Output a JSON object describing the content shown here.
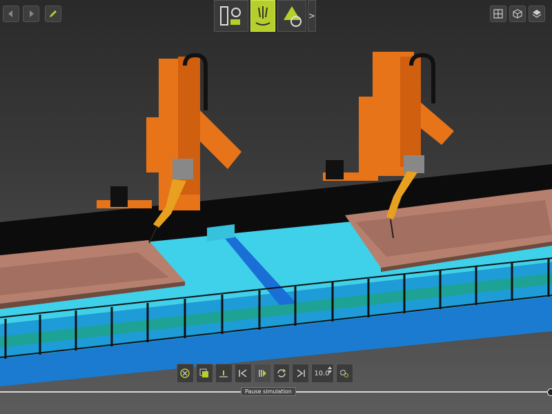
{
  "toolbar": {
    "left_buttons": [
      "back-icon",
      "forward-icon",
      "pencil-icon"
    ],
    "modes": [
      "layout-mode-icon",
      "simulation-mode-icon",
      "shapes-mode-icon"
    ],
    "active_mode": "simulation-mode-icon",
    "more_label": ">",
    "right_buttons": [
      "grid-view-icon",
      "cube-view-icon",
      "layers-icon"
    ]
  },
  "playback": {
    "buttons": [
      "stop-icon",
      "snapshot-icon",
      "marker-icon",
      "skip-start-icon",
      "play-pause-icon",
      "loop-icon",
      "skip-end-icon",
      "settings-gear-icon"
    ],
    "speed_value": "10.0",
    "tooltip": "Pause simulation"
  },
  "colors": {
    "robot_orange": "#e8741a",
    "water_cyan": "#3fd0ea",
    "floor_blue": "#1b8fe0",
    "active_green": "#b7cf2a",
    "fixture_brown": "#b7806e"
  }
}
